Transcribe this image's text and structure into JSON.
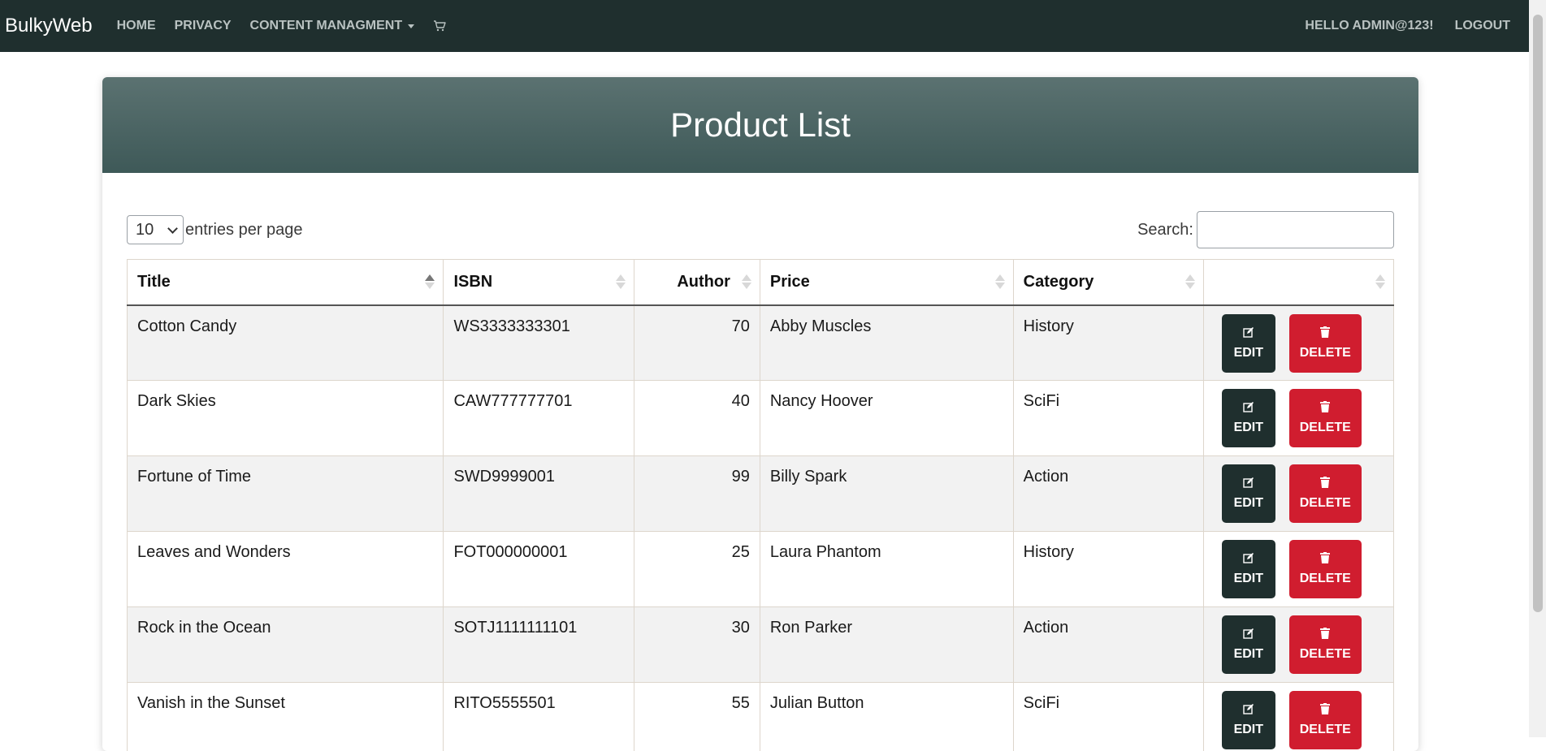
{
  "nav": {
    "brand": "BulkyWeb",
    "links": [
      "Home",
      "Privacy",
      "Content Managment"
    ],
    "user_greeting": "Hello admin@123!",
    "logout": "Logout",
    "icons": [
      "cart-icon",
      "caret-down-icon"
    ]
  },
  "card": {
    "title": "Product List"
  },
  "controls": {
    "page_size_value": "10",
    "entries_label": "entries per page",
    "search_label": "Search:",
    "search_value": ""
  },
  "table": {
    "columns": [
      "Title",
      "ISBN",
      "Author",
      "Price",
      "Category",
      ""
    ],
    "sorted_column": "Title",
    "sort_direction": "ascending",
    "rows": [
      {
        "title": "Cotton Candy",
        "isbn": "WS3333333301",
        "author": "70",
        "price": "Abby Muscles",
        "category": "History"
      },
      {
        "title": "Dark Skies",
        "isbn": "CAW777777701",
        "author": "40",
        "price": "Nancy Hoover",
        "category": "SciFi"
      },
      {
        "title": "Fortune of Time",
        "isbn": "SWD9999001",
        "author": "99",
        "price": "Billy Spark",
        "category": "Action"
      },
      {
        "title": "Leaves and Wonders",
        "isbn": "FOT000000001",
        "author": "25",
        "price": "Laura Phantom",
        "category": "History"
      },
      {
        "title": "Rock in the Ocean",
        "isbn": "SOTJ1111111101",
        "author": "30",
        "price": "Ron Parker",
        "category": "Action"
      },
      {
        "title": "Vanish in the Sunset",
        "isbn": "RITO5555501",
        "author": "55",
        "price": "Julian Button",
        "category": "SciFi"
      }
    ],
    "edit_label": "Edit",
    "delete_label": "Delete"
  },
  "colors": {
    "navbar_bg": "#1f2f2e",
    "header_gradient_top": "#5b7271",
    "header_gradient_bottom": "#3e5958",
    "edit_button": "#1f2f2e",
    "delete_button": "#d01d2f"
  }
}
